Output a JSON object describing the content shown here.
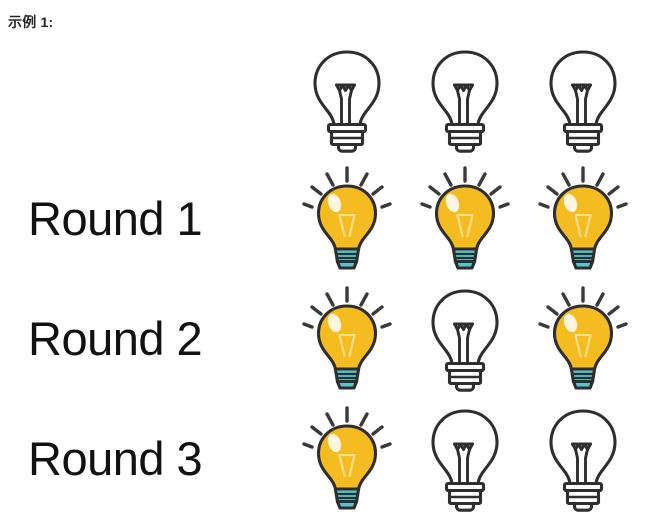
{
  "page": {
    "title": "示例 1:",
    "background_color": "#ffffff"
  },
  "colors": {
    "bulb_on_glass": "#F5BC21",
    "bulb_on_glass_shadow": "#E8A81C",
    "bulb_on_base": "#56C5CE",
    "bulb_on_base_dark": "#3FB0BC",
    "bulb_on_highlight": "#FFFFFF",
    "bulb_outline": "#2E2E2E",
    "bulb_off_fill": "#FFFFFF",
    "ray_color": "#3A3A3A",
    "label_text": "#111111",
    "title_text": "#262626"
  },
  "legend": {
    "on_state_name": "lightbulb-on-icon",
    "off_state_name": "lightbulb-off-icon"
  },
  "grid": {
    "column_count": 3,
    "rows": [
      {
        "id": "header",
        "label": "",
        "has_label": false,
        "bulbs": [
          "off",
          "off",
          "off"
        ]
      },
      {
        "id": "round-1",
        "label": "Round 1",
        "has_label": true,
        "bulbs": [
          "on",
          "on",
          "on"
        ]
      },
      {
        "id": "round-2",
        "label": "Round 2",
        "has_label": true,
        "bulbs": [
          "on",
          "off",
          "on"
        ]
      },
      {
        "id": "round-3",
        "label": "Round 3",
        "has_label": true,
        "bulbs": [
          "on",
          "off",
          "off"
        ]
      }
    ]
  }
}
